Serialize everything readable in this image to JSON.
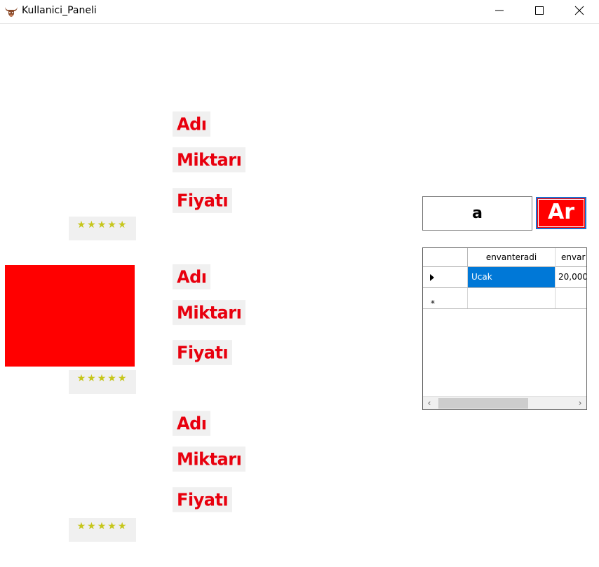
{
  "window": {
    "title": "Kullanici_Paneli",
    "icon": "bull-head-icon"
  },
  "products": [
    {
      "name_label": "Adı",
      "quantity_label": "Miktarı",
      "price_label": "Fiyatı",
      "rating": "★★★★★"
    },
    {
      "name_label": "Adı",
      "quantity_label": "Miktarı",
      "price_label": "Fiyatı",
      "rating": "★★★★★"
    },
    {
      "name_label": "Adı",
      "quantity_label": "Miktarı",
      "price_label": "Fiyatı",
      "rating": "★★★★★"
    }
  ],
  "search": {
    "value": "a",
    "button_label": "Ar"
  },
  "grid": {
    "columns": [
      "envanteradi",
      "envar"
    ],
    "rows": [
      {
        "envanteradi": "Ucak",
        "col2": "20,000"
      }
    ]
  },
  "colors": {
    "label_text": "#e8000e",
    "label_bg": "#f0f0f0",
    "stars": "#c6c61a",
    "image_placeholder": "#ff0000",
    "selection": "#0078d7",
    "button_border": "#1a6fd0"
  }
}
